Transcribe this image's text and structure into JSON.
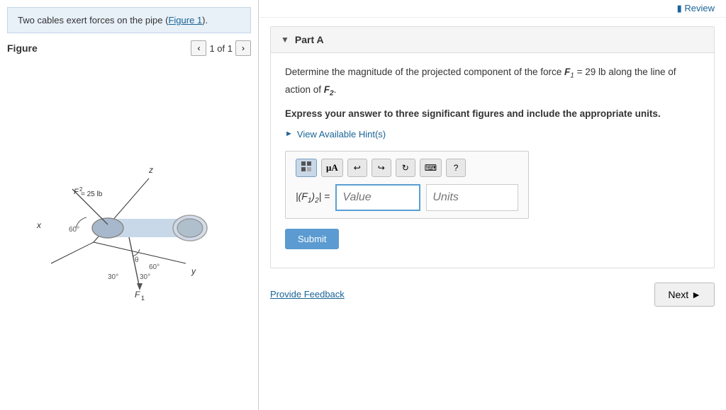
{
  "left": {
    "problem_text": "Two cables exert forces on the pipe (",
    "figure_link": "Figure 1",
    "figure_link_end": ").",
    "figure_title": "Figure",
    "figure_counter": "1 of 1"
  },
  "right": {
    "review_link": "Review",
    "part_label": "Part A",
    "problem_statement_1": "Determine the magnitude of the projected component of the force ",
    "force_f1": "F",
    "force_f1_sub": "1",
    "force_value": " = 29 lb",
    "problem_statement_2": " along the line of action of ",
    "force_f2": "F",
    "force_f2_sub": "2",
    "problem_statement_3": ".",
    "bold_instruction": "Express your answer to three significant figures and include the appropriate units.",
    "hint_label": "View Available Hint(s)",
    "answer_label": "|(F₁)₂| =",
    "value_placeholder": "Value",
    "units_placeholder": "Units",
    "submit_label": "Submit",
    "feedback_label": "Provide Feedback",
    "next_label": "Next",
    "toolbar": {
      "matrix_icon": "matrix",
      "mu_icon": "μA",
      "undo_icon": "↩",
      "redo_icon": "↪",
      "refresh_icon": "↻",
      "keyboard_icon": "⌨",
      "help_icon": "?"
    }
  }
}
